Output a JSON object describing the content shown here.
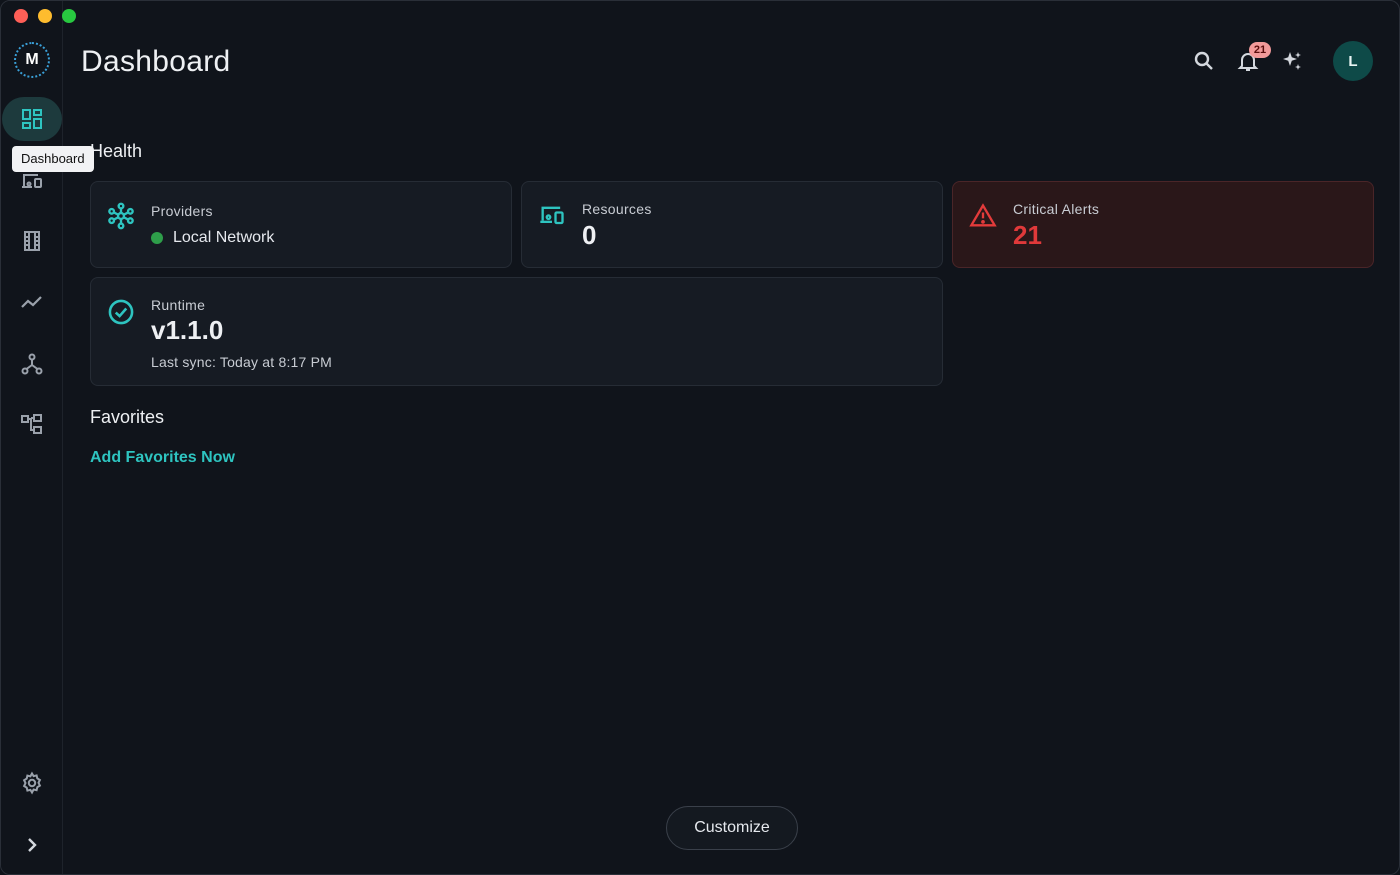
{
  "window": {
    "controls": [
      "close",
      "minimize",
      "maximize"
    ]
  },
  "sidebar": {
    "logo_letter": "M",
    "tooltip": "Dashboard",
    "items": [
      {
        "name": "dashboard",
        "icon": "dashboard-icon",
        "active": true
      },
      {
        "name": "resources",
        "icon": "devices-icon",
        "active": false
      },
      {
        "name": "catalog",
        "icon": "film-strip-icon",
        "active": false
      },
      {
        "name": "metrics",
        "icon": "trend-line-icon",
        "active": false
      },
      {
        "name": "topology",
        "icon": "network-tree-icon",
        "active": false
      },
      {
        "name": "workflows",
        "icon": "hierarchy-icon",
        "active": false
      }
    ],
    "settings_icon": "gear-icon",
    "expand_icon": "chevron-right-icon"
  },
  "header": {
    "title": "Dashboard",
    "notification_count": "21",
    "avatar_initial": "L",
    "icons": [
      "search-icon",
      "bell-icon",
      "sparkle-icon"
    ]
  },
  "health": {
    "title": "Health",
    "providers": {
      "label": "Providers",
      "value": "Local Network",
      "status_color": "#2e9e4a"
    },
    "resources": {
      "label": "Resources",
      "value": "0"
    },
    "alerts": {
      "label": "Critical Alerts",
      "value": "21",
      "color": "#e0393a"
    },
    "runtime": {
      "label": "Runtime",
      "version": "v1.1.0",
      "last_sync": "Last sync: Today at 8:17 PM"
    }
  },
  "favorites": {
    "title": "Favorites",
    "add_link": "Add Favorites Now"
  },
  "footer": {
    "customize_label": "Customize"
  },
  "colors": {
    "accent": "#2ec4c0",
    "alert": "#e0393a",
    "background": "#10141b"
  }
}
